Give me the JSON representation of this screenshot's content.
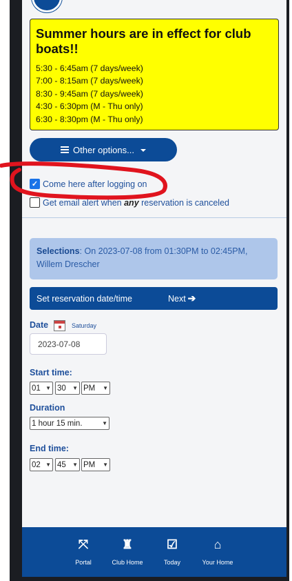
{
  "notice": {
    "title": "Summer hours are in effect for club boats!!",
    "hours": [
      "5:30 - 6:45am (7 days/week)",
      "7:00 - 8:15am (7 days/week)",
      "8:30 - 9:45am (7 days/week)",
      "4:30 - 6:30pm (M - Thu only)",
      "6:30 - 8:30pm (M - Thu only)"
    ]
  },
  "options_button": {
    "label": "Other options..."
  },
  "checkboxes": {
    "come_here": {
      "label": "Come here after logging on",
      "checked": true
    },
    "email_alert": {
      "label_before": "Get email alert when ",
      "label_em": "any",
      "label_after": " reservation is canceled",
      "checked": false
    }
  },
  "selection": {
    "label": "Selections",
    "text": ": On 2023-07-08 from 01:30PM to 02:45PM, Willem Drescher"
  },
  "date_bar": {
    "label": "Set reservation date/time",
    "next_label": "Next",
    "next_icon": "arrow-right-icon"
  },
  "date": {
    "label": "Date",
    "weekday": "Saturday",
    "value": "2023-07-08"
  },
  "start_time": {
    "label": "Start time:",
    "hour": "01",
    "minute": "30",
    "ampm": "PM"
  },
  "duration": {
    "label": "Duration",
    "value": "1 hour 15 min."
  },
  "end_time": {
    "label": "End time:",
    "hour": "02",
    "minute": "45",
    "ampm": "PM"
  },
  "footer_nav": [
    {
      "label": "Portal",
      "icon": "expand-arrows-icon",
      "glyph": "⤧"
    },
    {
      "label": "Club Home",
      "icon": "castle-icon",
      "glyph": "♜"
    },
    {
      "label": "Today",
      "icon": "calendar-check-icon",
      "glyph": "☑"
    },
    {
      "label": "Your Home",
      "icon": "home-icon",
      "glyph": "⌂"
    }
  ],
  "colors": {
    "primary": "#0c4b97",
    "notice_bg": "#ffff00",
    "selection_bg": "#aec6ea",
    "annotation": "#e0141e"
  }
}
